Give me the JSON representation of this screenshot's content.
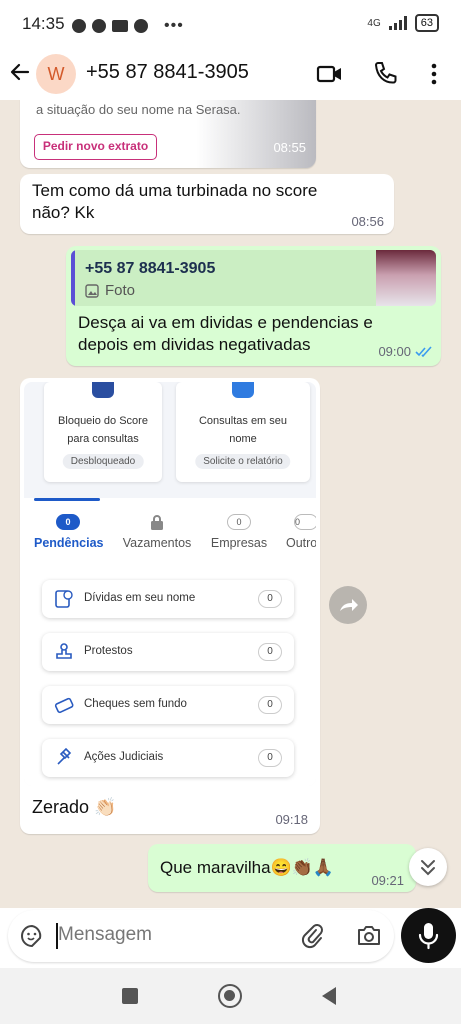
{
  "status_bar": {
    "time": "14:35",
    "network": "4G",
    "battery": "63"
  },
  "header": {
    "avatar_initial": "W",
    "contact": "+55 87 8841-3905"
  },
  "messages": {
    "card_top": {
      "subtitle": "a situação do seu nome na Serasa.",
      "button": "Pedir novo extrato",
      "time": "08:55"
    },
    "incoming_1": {
      "text_line1": "Tem como dá uma turbinada no score",
      "text_line2": "não? Kk",
      "time": "08:56"
    },
    "outgoing_reply": {
      "quoted_name": "+55 87 8841-3905",
      "quoted_type": "Foto",
      "text_line1": "Desça ai va em dividas e pendencias e",
      "text_line2": "depois em dividas negativadas",
      "time": "09:00"
    },
    "screenshot": {
      "tiles": [
        {
          "label_line1": "Bloqueio do Score",
          "label_line2": "para consultas",
          "badge": "Desbloqueado"
        },
        {
          "label_line1": "Consultas em seu",
          "label_line2": "nome",
          "badge": "Solicite o relatório"
        }
      ],
      "tabs": [
        {
          "label": "Pendências",
          "count": "0"
        },
        {
          "label": "Vazamentos",
          "count": ""
        },
        {
          "label": "Empresas",
          "count": "0"
        },
        {
          "label": "Outro",
          "count": "0"
        }
      ],
      "rows": [
        {
          "label": "Dívidas em seu nome",
          "count": "0"
        },
        {
          "label": "Protestos",
          "count": "0"
        },
        {
          "label": "Cheques sem fundo",
          "count": "0"
        },
        {
          "label": "Ações Judiciais",
          "count": "0"
        }
      ],
      "caption": "Zerado 👏🏻",
      "time": "09:18"
    },
    "outgoing_last": {
      "text": "Que maravilha😄👏🏾🙏🏾",
      "time": "09:21"
    }
  },
  "input": {
    "placeholder": "Mensagem"
  },
  "colors": {
    "accent_blue": "#1e5ac8",
    "serasa_pink": "#c8307a",
    "outgoing_bubble": "#d9fdd3",
    "chat_bg": "#efe7dd"
  }
}
